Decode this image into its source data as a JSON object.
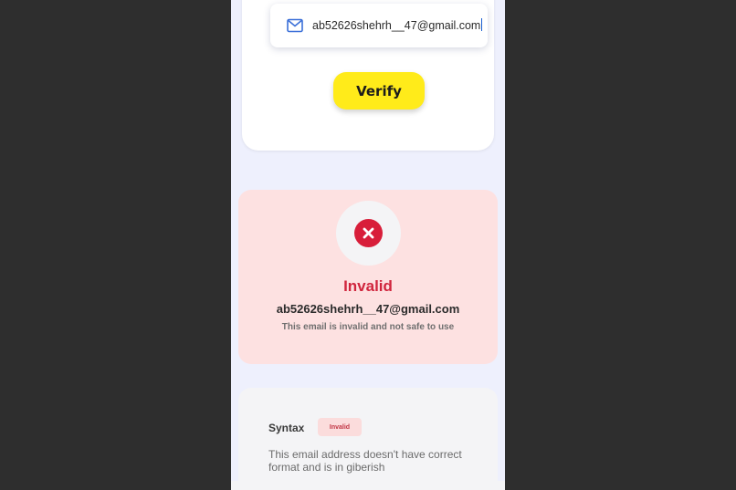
{
  "email_input": {
    "value": "ab52626shehrh__47@gmail.com",
    "icon": "mail-icon"
  },
  "verify_button": {
    "label": "Verify",
    "color": "#ffeb1a"
  },
  "result": {
    "status": "Invalid",
    "email": "ab52626shehrh__47@gmail.com",
    "description": "This email is invalid and not safe to use",
    "icon": "close-circle-icon",
    "status_color": "#d0253d",
    "card_color": "#fde1e1"
  },
  "syntax": {
    "label": "Syntax",
    "badge": "Invalid",
    "description": "This email address doesn't have correct format and is in giberish"
  }
}
